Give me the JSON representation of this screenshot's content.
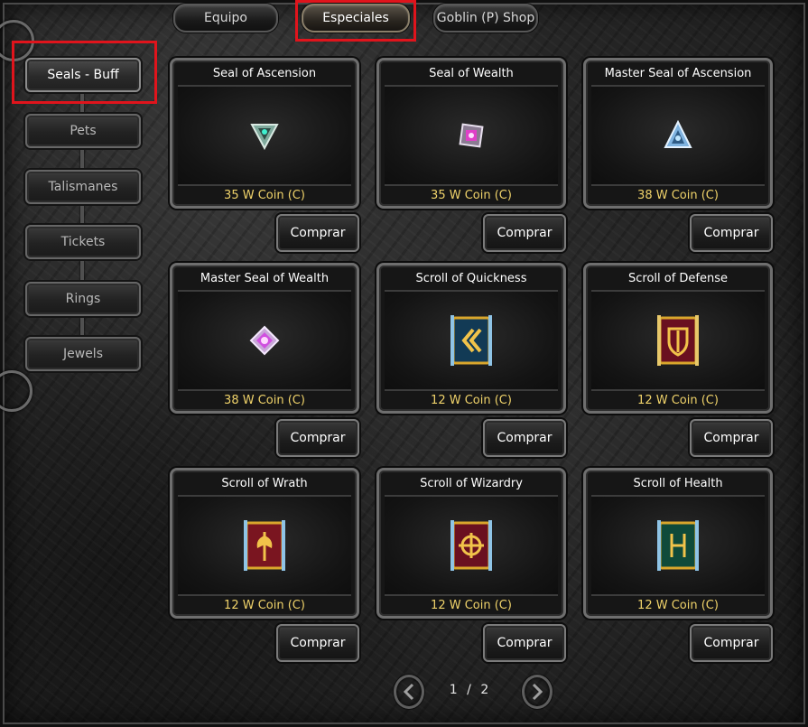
{
  "tabs": [
    {
      "label": "Equipo",
      "active": false
    },
    {
      "label": "Especiales",
      "active": true
    },
    {
      "label": "Goblin (P) Shop",
      "active": false
    }
  ],
  "sidebar": {
    "items": [
      {
        "label": "Seals - Buff",
        "active": true
      },
      {
        "label": "Pets",
        "active": false
      },
      {
        "label": "Talismanes",
        "active": false
      },
      {
        "label": "Tickets",
        "active": false
      },
      {
        "label": "Rings",
        "active": false
      },
      {
        "label": "Jewels",
        "active": false
      }
    ]
  },
  "buy_label": "Comprar",
  "items": [
    {
      "name": "Seal of Ascension",
      "price": "35 W Coin (C)",
      "icon": "seal-of-ascension-icon"
    },
    {
      "name": "Seal of Wealth",
      "price": "35 W Coin (C)",
      "icon": "seal-of-wealth-icon"
    },
    {
      "name": "Master Seal of Ascension",
      "price": "38 W Coin (C)",
      "icon": "master-seal-of-ascension-icon"
    },
    {
      "name": "Master Seal of Wealth",
      "price": "38 W Coin (C)",
      "icon": "master-seal-of-wealth-icon"
    },
    {
      "name": "Scroll of Quickness",
      "price": "12 W Coin (C)",
      "icon": "scroll-of-quickness-icon"
    },
    {
      "name": "Scroll of Defense",
      "price": "12 W Coin (C)",
      "icon": "scroll-of-defense-icon"
    },
    {
      "name": "Scroll of Wrath",
      "price": "12 W Coin (C)",
      "icon": "scroll-of-wrath-icon"
    },
    {
      "name": "Scroll of Wizardry",
      "price": "12 W Coin (C)",
      "icon": "scroll-of-wizardry-icon"
    },
    {
      "name": "Scroll of Health",
      "price": "12 W Coin (C)",
      "icon": "scroll-of-health-icon"
    }
  ],
  "pagination": {
    "current": "1",
    "separator": "/",
    "total": "2",
    "prev_icon": "arrow-left-icon",
    "next_icon": "arrow-right-icon"
  },
  "colors": {
    "price_text": "#f0d36a",
    "highlight": "#e0141c"
  }
}
